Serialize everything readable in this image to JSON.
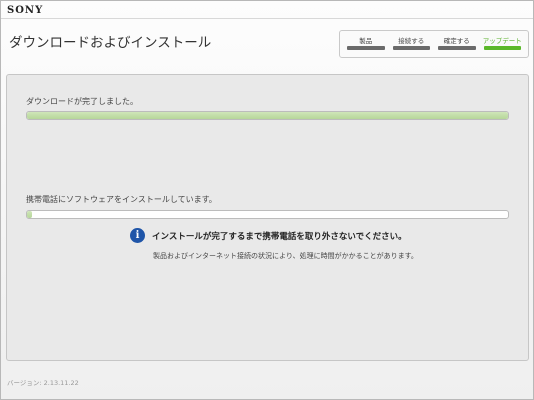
{
  "header": {
    "brand": "SONY",
    "title": "ダウンロードおよびインストール"
  },
  "steps": [
    {
      "label": "製品"
    },
    {
      "label": "接続する"
    },
    {
      "label": "確定する"
    },
    {
      "label": "アップデート",
      "active": true
    }
  ],
  "download": {
    "status": "ダウンロードが完了しました。",
    "progress_percent": 100
  },
  "install": {
    "status": "携帯電話にソフトウェアをインストールしています。",
    "progress_percent": 1
  },
  "notice": {
    "icon": "info-icon",
    "text": "インストールが完了するまで携帯電話を取り外さないでください。",
    "subtext": "製品およびインターネット接続の状況により、処理に時間がかかることがあります。"
  },
  "footer": {
    "version": "バージョン: 2.13.11.22"
  },
  "colors": {
    "accent_green": "#5bb82a",
    "info_blue": "#1f55a8"
  }
}
